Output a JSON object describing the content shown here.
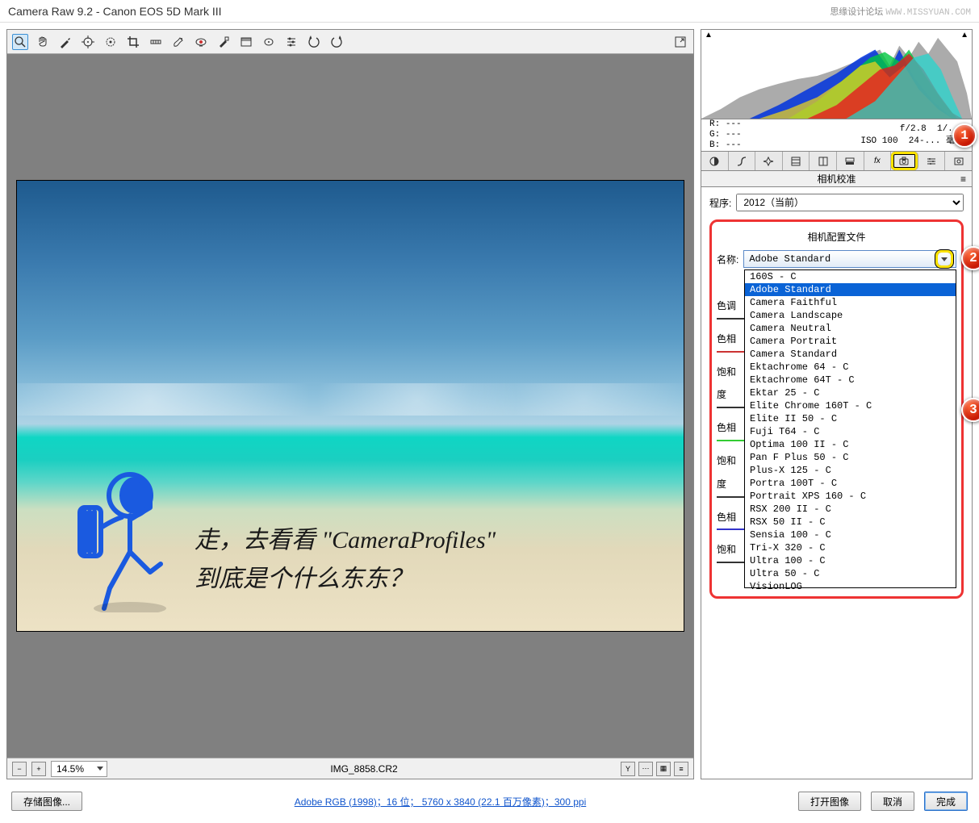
{
  "title": "Camera Raw 9.2  -  Canon EOS 5D Mark III",
  "branding": {
    "text": "思缘设计论坛",
    "url": "WWW.MISSYUAN.COM"
  },
  "toolbar_icons": [
    "zoom",
    "hand",
    "eyedropper",
    "color-sampler",
    "target-adjust",
    "crop",
    "straighten",
    "spot-removal",
    "redeye",
    "adjustment-brush",
    "graduated-filter",
    "radial-filter",
    "rotate-left",
    "rotate-right",
    "prefs"
  ],
  "preview_text1": "走，去看看 \"CameraProfiles\"",
  "preview_text2": "到底是个什么东东？",
  "status": {
    "zoom": "14.5%",
    "filename": "IMG_8858.CR2"
  },
  "info": {
    "r": "R:",
    "g": "G:",
    "b": "B:",
    "dash": "---",
    "aperture": "f/2.8",
    "exposure": "1/...",
    "iso": "ISO 100",
    "lens": "24-... 毫米"
  },
  "tab_title": "相机校准",
  "process_label": "程序:",
  "process_value": "2012（当前）",
  "profile_section": "相机配置文件",
  "name_label": "名称:",
  "name_value": "Adobe Standard",
  "dropdown_items": [
    "160S - C",
    "Adobe Standard",
    "Camera Faithful",
    "Camera Landscape",
    "Camera Neutral",
    "Camera Portrait",
    "Camera Standard",
    "Ektachrome 64 - C",
    "Ektachrome 64T - C",
    "Ektar 25 - C",
    "Elite Chrome 160T - C",
    "Elite II 50 - C",
    "Fuji T64 - C",
    "Optima 100 II - C",
    "Pan F Plus 50 - C",
    "Plus-X 125 - C",
    "Portra 100T - C",
    "Portrait XPS 160 - C",
    "RSX 200 II - C",
    "RSX 50 II - C",
    "Sensia 100  - C",
    "Tri-X 320 - C",
    "Ultra 100 - C",
    "Ultra 50 - C",
    "VisionLOG"
  ],
  "selected_index": 1,
  "hidden_sliders": [
    "色调",
    "色相",
    "饱和度",
    "色相",
    "饱和度",
    "色相",
    "饱和"
  ],
  "callouts": {
    "1": 1,
    "2": 2,
    "3": 3
  },
  "footer": {
    "save": "存储图像...",
    "link": "Adobe RGB (1998)；16 位； 5760 x 3840 (22.1 百万像素)；300 ppi",
    "open": "打开图像",
    "cancel": "取消",
    "done": "完成"
  }
}
